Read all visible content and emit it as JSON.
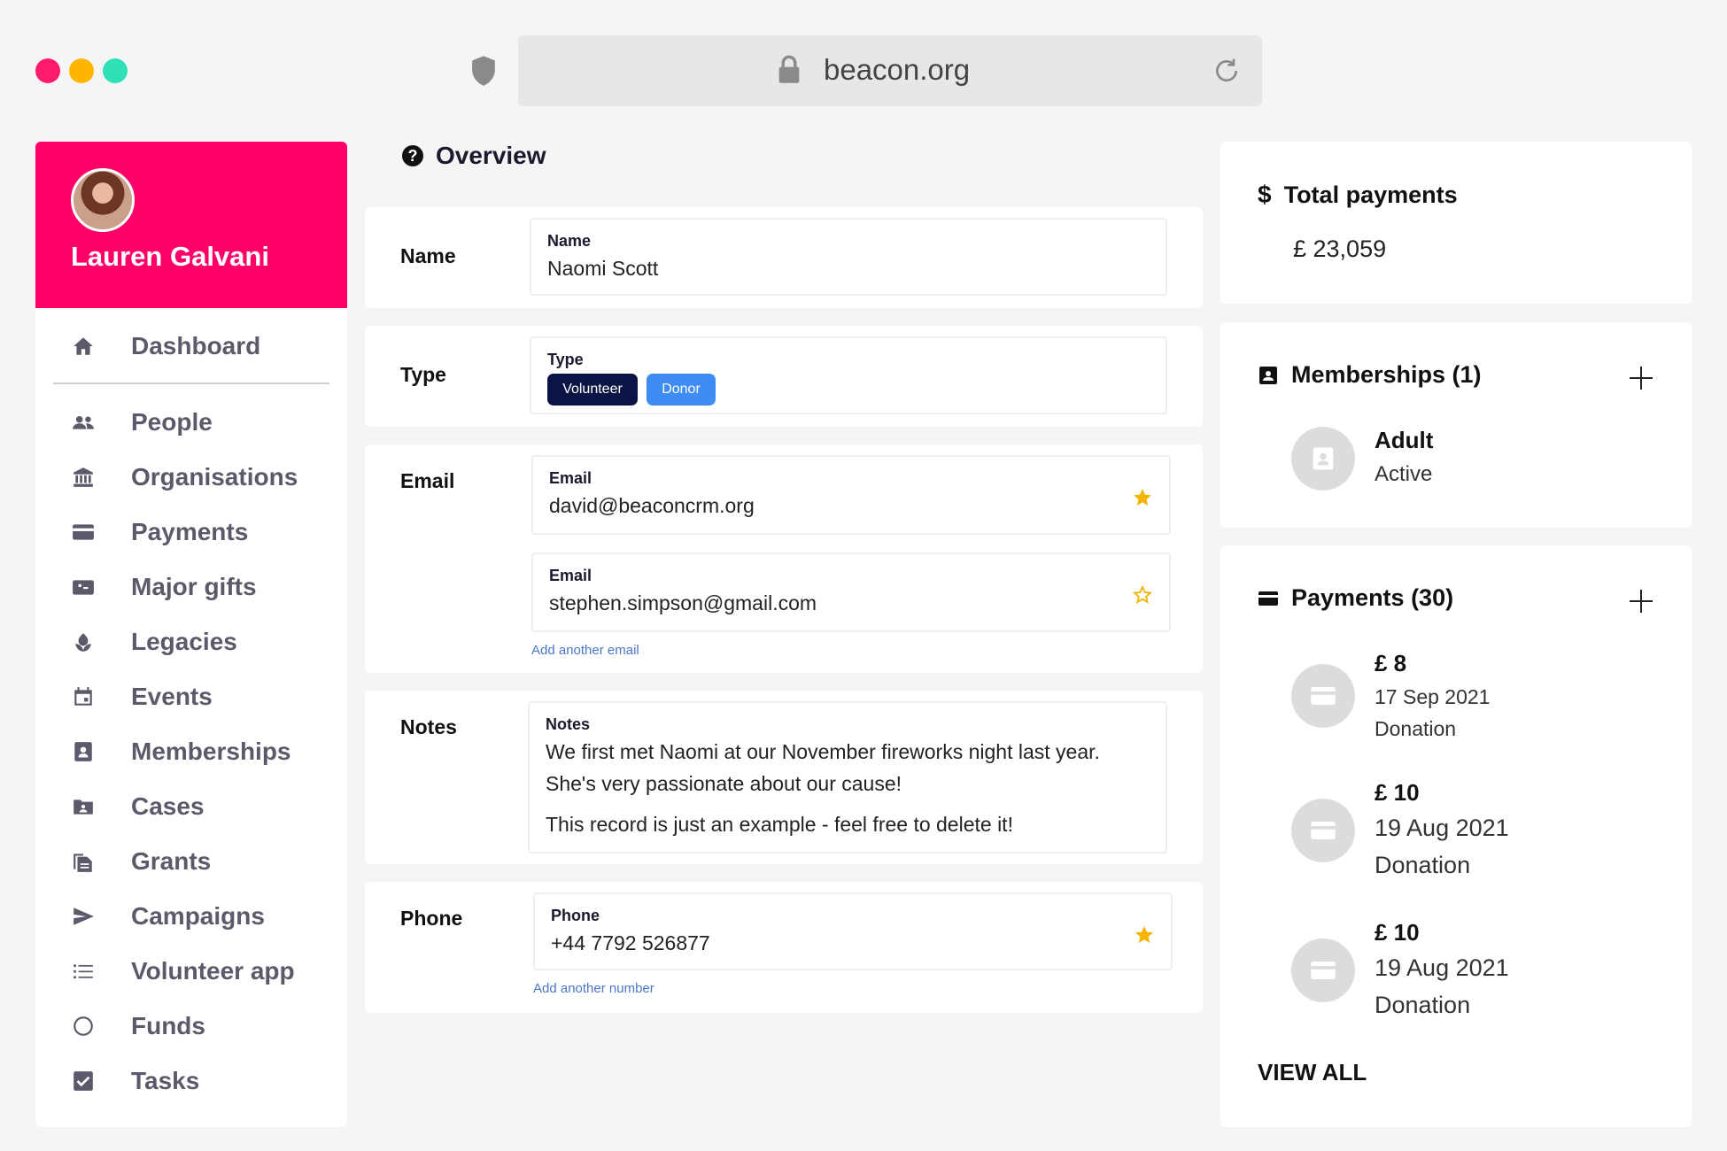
{
  "browser": {
    "url": "beacon.org",
    "traffic_colors": [
      "#ff1a6c",
      "#ffb400",
      "#2ee0b6"
    ]
  },
  "sidebar": {
    "user_name": "Lauren Galvani",
    "accent_color": "#ff0069",
    "items": [
      {
        "label": "Dashboard",
        "icon": "home-icon"
      },
      {
        "label": "People",
        "icon": "people-icon"
      },
      {
        "label": "Organisations",
        "icon": "bank-icon"
      },
      {
        "label": "Payments",
        "icon": "card-icon"
      },
      {
        "label": "Major gifts",
        "icon": "gift-card-icon"
      },
      {
        "label": "Legacies",
        "icon": "flower-icon"
      },
      {
        "label": "Events",
        "icon": "calendar-icon"
      },
      {
        "label": "Memberships",
        "icon": "member-card-icon"
      },
      {
        "label": "Cases",
        "icon": "case-folder-icon"
      },
      {
        "label": "Grants",
        "icon": "documents-icon"
      },
      {
        "label": "Campaigns",
        "icon": "send-icon"
      },
      {
        "label": "Volunteer app",
        "icon": "list-icon"
      },
      {
        "label": "Funds",
        "icon": "circle-icon"
      },
      {
        "label": "Tasks",
        "icon": "checkbox-icon"
      }
    ]
  },
  "overview": {
    "title": "Overview",
    "name": {
      "label": "Name",
      "field_label": "Name",
      "value": "Naomi Scott"
    },
    "type": {
      "label": "Type",
      "field_label": "Type",
      "tags": [
        "Volunteer",
        "Donor"
      ],
      "tag_colors": [
        "#0c1445",
        "#3f8cf5"
      ]
    },
    "email": {
      "label": "Email",
      "entries": [
        {
          "field_label": "Email",
          "value": "david@beaconcrm.org",
          "primary": true
        },
        {
          "field_label": "Email",
          "value": "stephen.simpson@gmail.com",
          "primary": false
        }
      ],
      "add_link": "Add another email"
    },
    "notes": {
      "label": "Notes",
      "field_label": "Notes",
      "line1": "We first met Naomi at our November fireworks night last year.",
      "line2": "She's very passionate about our cause!",
      "line3": "This record is just an example - feel free to delete it!"
    },
    "phone": {
      "label": "Phone",
      "field_label": "Phone",
      "value": "+44 7792 526877",
      "add_link": "Add another number"
    }
  },
  "right": {
    "total": {
      "title": "Total payments",
      "amount": "£ 23,059"
    },
    "memberships": {
      "title": "Memberships (1)",
      "item_title": "Adult",
      "item_status": "Active"
    },
    "payments": {
      "title": "Payments (30)",
      "items": [
        {
          "amount": "£ 8",
          "date": "17 Sep 2021",
          "kind": "Donation"
        },
        {
          "amount": "£ 10",
          "date": "19 Aug 2021",
          "kind": "Donation"
        },
        {
          "amount": "£ 10",
          "date": "19 Aug 2021",
          "kind": "Donation"
        }
      ],
      "view_all": "VIEW ALL"
    }
  },
  "star_color": "#f5b400"
}
